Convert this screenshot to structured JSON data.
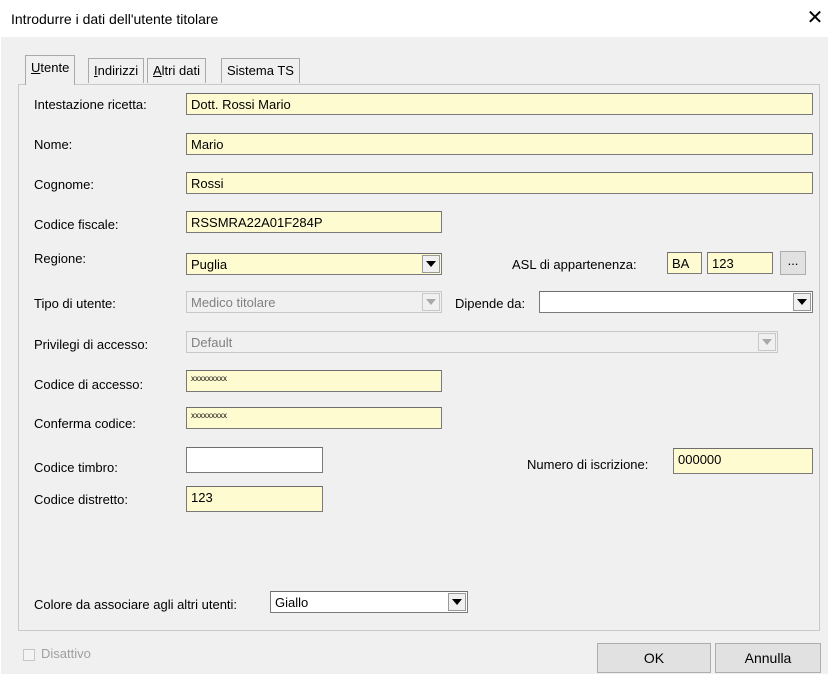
{
  "window": {
    "title": "Introdurre i dati dell'utente titolare",
    "close_glyph": "✕"
  },
  "tabs": [
    {
      "label_first": "U",
      "label_rest": "tente"
    },
    {
      "label_first": "I",
      "label_rest": "ndirizzi"
    },
    {
      "label_first": "A",
      "label_rest": "ltri dati"
    },
    {
      "label_full": "Sistema TS"
    }
  ],
  "form": {
    "intestazione_label": "Intestazione ricetta:",
    "intestazione_value": "Dott. Rossi Mario",
    "nome_label": "Nome:",
    "nome_value": "Mario",
    "cognome_label": "Cognome:",
    "cognome_value": "Rossi",
    "cf_label": "Codice fiscale:",
    "cf_value": "RSSMRA22A01F284P",
    "regione_label": "Regione:",
    "regione_value": "Puglia",
    "asl_label": "ASL di appartenenza:",
    "asl_code": "BA",
    "asl_num": "123",
    "asl_more": "...",
    "tipo_label": "Tipo di utente:",
    "tipo_value": "Medico titolare",
    "dipende_label": "Dipende da:",
    "dipende_value": "",
    "privilegi_label": "Privilegi di accesso:",
    "privilegi_value": "Default",
    "accesso_label": "Codice di accesso:",
    "accesso_value": "xxxxxxxxx",
    "conferma_label": "Conferma codice:",
    "conferma_value": "xxxxxxxxx",
    "timbro_label": "Codice timbro:",
    "timbro_value": "",
    "iscrizione_label": "Numero di iscrizione:",
    "iscrizione_value": "000000",
    "distretto_label": "Codice distretto:",
    "distretto_value": "123",
    "colore_label": "Colore da associare agli altri utenti:",
    "colore_value": "Giallo"
  },
  "footer": {
    "disattivo_label": "Disattivo",
    "ok_label": "OK",
    "annulla_label": "Annulla"
  }
}
